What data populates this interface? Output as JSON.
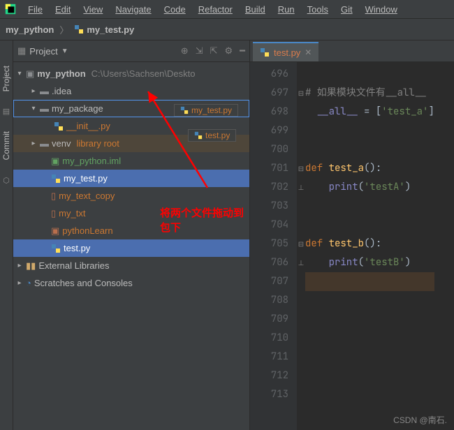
{
  "menu": [
    "File",
    "Edit",
    "View",
    "Navigate",
    "Code",
    "Refactor",
    "Build",
    "Run",
    "Tools",
    "Git",
    "Window"
  ],
  "breadcrumb": {
    "project": "my_python",
    "file": "my_test.py"
  },
  "sidebar": {
    "project": "Project",
    "commit": "Commit"
  },
  "proj_header": {
    "label": "Project"
  },
  "tree": {
    "root": "my_python",
    "root_path": "C:\\Users\\Sachsen\\Deskto",
    "idea": ".idea",
    "my_package": "my_package",
    "init": "__init__.py",
    "venv": "venv",
    "venv_note": "library root",
    "iml": "my_python.iml",
    "mytest": "my_test.py",
    "mytextcopy": "my_text_copy",
    "mytxt": "my_txt",
    "pylearn": "pythonLearn",
    "testpy": "test.py",
    "ext": "External Libraries",
    "scratch": "Scratches and Consoles"
  },
  "drag": {
    "ghost1": "my_test.py",
    "ghost2": "test.py"
  },
  "annotation": "将两个文件拖动到包下",
  "tab": {
    "label": "test.py"
  },
  "gutter": [
    "696",
    "697",
    "698",
    "699",
    "700",
    "701",
    "702",
    "703",
    "704",
    "705",
    "706",
    "707",
    "708",
    "709",
    "710",
    "711",
    "712",
    "713"
  ],
  "code": {
    "l697_cmt": "# 如果模块文件有__all__",
    "l698_a": "__all__",
    "l698_b": " = [",
    "l698_c": "'test_a'",
    "l698_d": "]",
    "l701_def": "def ",
    "l701_fn": "test_a",
    "l701_tail": "():",
    "l702_print": "print",
    "l702_arg": "'testA'",
    "l705_def": "def ",
    "l705_fn": "test_b",
    "l705_tail": "():",
    "l706_print": "print",
    "l706_arg": "'testB'"
  },
  "watermark": "CSDN @南石."
}
